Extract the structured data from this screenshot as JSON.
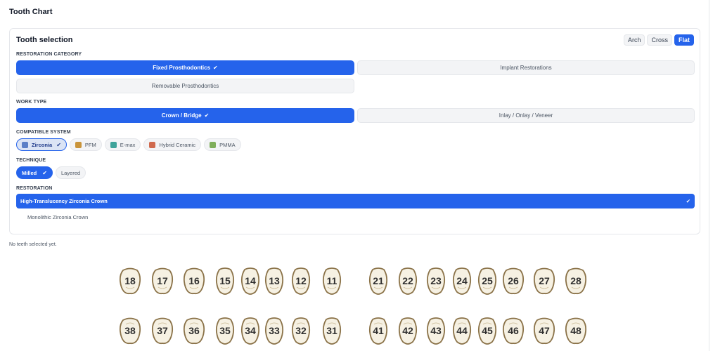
{
  "page": {
    "title": "Tooth Chart",
    "status_note": "No teeth selected yet."
  },
  "panel": {
    "title": "Tooth selection",
    "views": [
      {
        "label": "Arch",
        "active": false
      },
      {
        "label": "Cross",
        "active": false
      },
      {
        "label": "Flat",
        "active": true
      }
    ]
  },
  "restoration_category": {
    "label": "RESTORATION CATEGORY",
    "options": [
      {
        "label": "Fixed Prosthodontics",
        "selected": true
      },
      {
        "label": "Implant Restorations",
        "selected": false
      },
      {
        "label": "Removable Prosthodontics",
        "selected": false
      }
    ]
  },
  "work_type": {
    "label": "WORK TYPE",
    "options": [
      {
        "label": "Crown / Bridge",
        "selected": true
      },
      {
        "label": "Inlay / Onlay / Veneer",
        "selected": false
      }
    ]
  },
  "compatible_system": {
    "label": "COMPATIBLE SYSTEM",
    "options": [
      {
        "label": "Zirconia",
        "color": "#5b7fc7",
        "selected": true
      },
      {
        "label": "PFM",
        "color": "#c9943a",
        "selected": false
      },
      {
        "label": "E-max",
        "color": "#3fa39a",
        "selected": false
      },
      {
        "label": "Hybrid Ceramic",
        "color": "#d06a4e",
        "selected": false
      },
      {
        "label": "PMMA",
        "color": "#7fae5a",
        "selected": false
      }
    ]
  },
  "technique": {
    "label": "TECHNIQUE",
    "options": [
      {
        "label": "Milled",
        "selected": true
      },
      {
        "label": "Layered",
        "selected": false
      }
    ]
  },
  "restoration": {
    "label": "RESTORATION",
    "options": [
      {
        "label": "High-Translucency Zirconia Crown",
        "selected": true
      },
      {
        "label": "Monolithic Zirconia Crown",
        "selected": false
      }
    ]
  },
  "check_glyph": "✔",
  "teeth": {
    "upper": [
      "18",
      "17",
      "16",
      "15",
      "14",
      "13",
      "12",
      "11",
      "21",
      "22",
      "23",
      "24",
      "25",
      "26",
      "27",
      "28"
    ],
    "lower": [
      "38",
      "37",
      "36",
      "35",
      "34",
      "33",
      "32",
      "31",
      "41",
      "42",
      "43",
      "44",
      "45",
      "46",
      "47",
      "48"
    ],
    "fill_color": "#f6f1e3",
    "stroke_color": "#8a7248"
  }
}
